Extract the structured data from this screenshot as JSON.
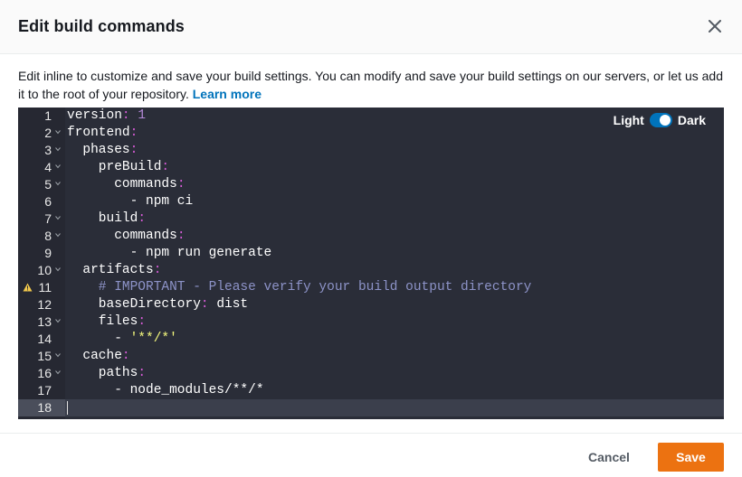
{
  "modal": {
    "title": "Edit build commands",
    "description": "Edit inline to customize and save your build settings. You can modify and save your build settings on our servers, or let us add it to the root of your repository.",
    "learn_more": "Learn more"
  },
  "editor": {
    "theme_light": "Light",
    "theme_dark": "Dark",
    "theme_selected": "Dark",
    "lines": [
      {
        "n": "1",
        "indent": 0,
        "fold": false,
        "warn": false,
        "tokens": [
          {
            "t": "version",
            "c": "k"
          },
          {
            "t": ": ",
            "c": "p"
          },
          {
            "t": "1",
            "c": "n"
          }
        ]
      },
      {
        "n": "2",
        "indent": 0,
        "fold": true,
        "warn": false,
        "tokens": [
          {
            "t": "frontend",
            "c": "k"
          },
          {
            "t": ":",
            "c": "p"
          }
        ]
      },
      {
        "n": "3",
        "indent": 1,
        "fold": true,
        "warn": false,
        "tokens": [
          {
            "t": "phases",
            "c": "k"
          },
          {
            "t": ":",
            "c": "p"
          }
        ]
      },
      {
        "n": "4",
        "indent": 2,
        "fold": true,
        "warn": false,
        "tokens": [
          {
            "t": "preBuild",
            "c": "k"
          },
          {
            "t": ":",
            "c": "p"
          }
        ]
      },
      {
        "n": "5",
        "indent": 3,
        "fold": true,
        "warn": false,
        "tokens": [
          {
            "t": "commands",
            "c": "k"
          },
          {
            "t": ":",
            "c": "p"
          }
        ]
      },
      {
        "n": "6",
        "indent": 4,
        "fold": false,
        "warn": false,
        "tokens": [
          {
            "t": "- npm ci",
            "c": "k"
          }
        ]
      },
      {
        "n": "7",
        "indent": 2,
        "fold": true,
        "warn": false,
        "tokens": [
          {
            "t": "build",
            "c": "k"
          },
          {
            "t": ":",
            "c": "p"
          }
        ]
      },
      {
        "n": "8",
        "indent": 3,
        "fold": true,
        "warn": false,
        "tokens": [
          {
            "t": "commands",
            "c": "k"
          },
          {
            "t": ":",
            "c": "p"
          }
        ]
      },
      {
        "n": "9",
        "indent": 4,
        "fold": false,
        "warn": false,
        "tokens": [
          {
            "t": "- npm run generate",
            "c": "k"
          }
        ]
      },
      {
        "n": "10",
        "indent": 1,
        "fold": true,
        "warn": false,
        "tokens": [
          {
            "t": "artifacts",
            "c": "k"
          },
          {
            "t": ":",
            "c": "p"
          }
        ]
      },
      {
        "n": "11",
        "indent": 2,
        "fold": false,
        "warn": true,
        "tokens": [
          {
            "t": "# IMPORTANT - Please verify your build output directory",
            "c": "c"
          }
        ]
      },
      {
        "n": "12",
        "indent": 2,
        "fold": false,
        "warn": false,
        "tokens": [
          {
            "t": "baseDirectory",
            "c": "k"
          },
          {
            "t": ": ",
            "c": "p"
          },
          {
            "t": "dist",
            "c": "k"
          }
        ]
      },
      {
        "n": "13",
        "indent": 2,
        "fold": true,
        "warn": false,
        "tokens": [
          {
            "t": "files",
            "c": "k"
          },
          {
            "t": ":",
            "c": "p"
          }
        ]
      },
      {
        "n": "14",
        "indent": 3,
        "fold": false,
        "warn": false,
        "tokens": [
          {
            "t": "- ",
            "c": "k"
          },
          {
            "t": "'**/*'",
            "c": "s"
          }
        ]
      },
      {
        "n": "15",
        "indent": 1,
        "fold": true,
        "warn": false,
        "tokens": [
          {
            "t": "cache",
            "c": "k"
          },
          {
            "t": ":",
            "c": "p"
          }
        ]
      },
      {
        "n": "16",
        "indent": 2,
        "fold": true,
        "warn": false,
        "tokens": [
          {
            "t": "paths",
            "c": "k"
          },
          {
            "t": ":",
            "c": "p"
          }
        ]
      },
      {
        "n": "17",
        "indent": 3,
        "fold": false,
        "warn": false,
        "tokens": [
          {
            "t": "- node_modules/**/*",
            "c": "k"
          }
        ]
      },
      {
        "n": "18",
        "indent": 0,
        "fold": false,
        "warn": false,
        "active": true,
        "tokens": []
      }
    ]
  },
  "footer": {
    "cancel_label": "Cancel",
    "save_label": "Save"
  },
  "colors": {
    "accent": "#0073bb",
    "primary_button": "#ec7211",
    "editor_bg": "#2a2d38"
  }
}
